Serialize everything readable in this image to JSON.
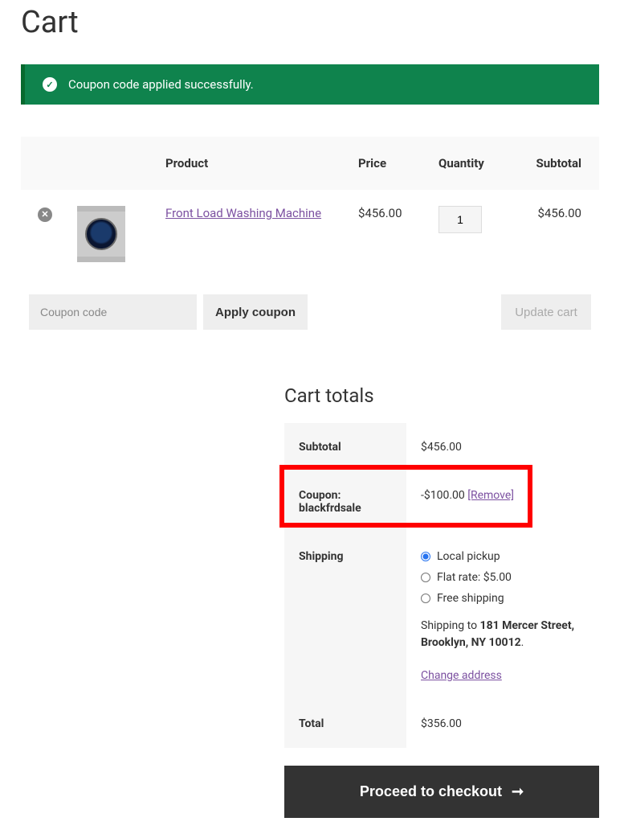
{
  "page": {
    "title": "Cart"
  },
  "message": {
    "text": "Coupon code applied successfully."
  },
  "cart_table": {
    "headers": {
      "product": "Product",
      "price": "Price",
      "quantity": "Quantity",
      "subtotal": "Subtotal"
    },
    "item": {
      "name": "Front Load Washing Machine",
      "price": "$456.00",
      "quantity": "1",
      "subtotal": "$456.00"
    },
    "coupon_placeholder": "Coupon code",
    "apply_label": "Apply coupon",
    "update_label": "Update cart"
  },
  "totals": {
    "heading": "Cart totals",
    "subtotal_label": "Subtotal",
    "subtotal_value": "$456.00",
    "coupon_label": "Coupon: blackfrdsale",
    "coupon_value": "-$100.00 ",
    "coupon_remove": "[Remove]",
    "shipping_label": "Shipping",
    "shipping": {
      "local_pickup": "Local pickup",
      "flat_rate": "Flat rate: $5.00",
      "free_shipping": "Free shipping",
      "shipping_to_prefix": "Shipping to ",
      "address": "181 Mercer Street, Brooklyn, NY 10012",
      "period": ".",
      "change_address": "Change address"
    },
    "total_label": "Total",
    "total_value": "$356.00",
    "checkout_label": "Proceed to checkout"
  }
}
